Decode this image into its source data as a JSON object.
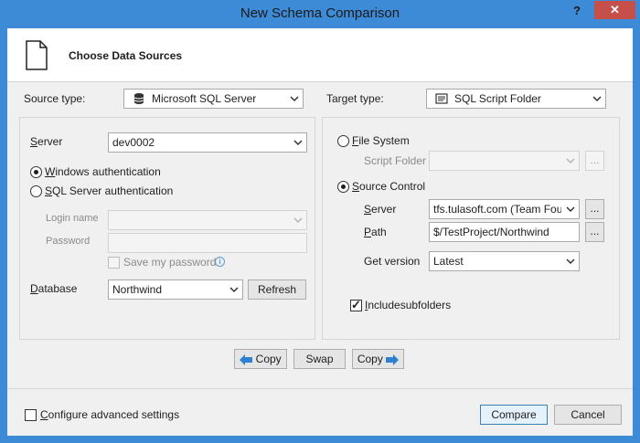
{
  "window": {
    "title": "New Schema Comparison",
    "help_glyph": "?",
    "close_glyph": "✕"
  },
  "header": {
    "title": "Choose Data Sources",
    "icon": "document-icon"
  },
  "source": {
    "type_label": "Source type:",
    "type_value": "Microsoft SQL Server",
    "server_label": "Server",
    "server_value": "dev0002",
    "windows_auth_label": "Windows authentication",
    "windows_auth_selected": true,
    "sql_auth_label": "SQL Server authentication",
    "sql_auth_selected": false,
    "login_label": "Login name",
    "login_value": "",
    "password_label": "Password",
    "password_value": "",
    "save_password_label": "Save my password",
    "save_password_checked": false,
    "database_label": "Database",
    "database_value": "Northwind",
    "refresh_label": "Refresh"
  },
  "target": {
    "type_label": "Target type:",
    "type_value": "SQL Script Folder",
    "file_system_label": "File System",
    "file_system_selected": false,
    "script_folder_label": "Script Folder",
    "script_folder_value": "",
    "source_control_label": "Source Control",
    "source_control_selected": true,
    "server_label": "Server",
    "server_value": "tfs.tulasoft.com (Team Found",
    "path_label": "Path",
    "path_value": "$/TestProject/Northwind",
    "get_version_label": "Get version",
    "get_version_value": "Latest",
    "include_subfolders_label": "Includesubfolders",
    "include_subfolders_checked": true,
    "browse_label": "..."
  },
  "middle_buttons": {
    "copy_left": "Copy",
    "swap": "Swap",
    "copy_right": "Copy"
  },
  "footer": {
    "advanced_label": "Configure advanced settings",
    "advanced_checked": false,
    "compare_label": "Compare",
    "cancel_label": "Cancel"
  },
  "colors": {
    "title_bar": "#3d8ad6",
    "close_button": "#c74f4a",
    "copy_arrow": "#2f80d1"
  }
}
